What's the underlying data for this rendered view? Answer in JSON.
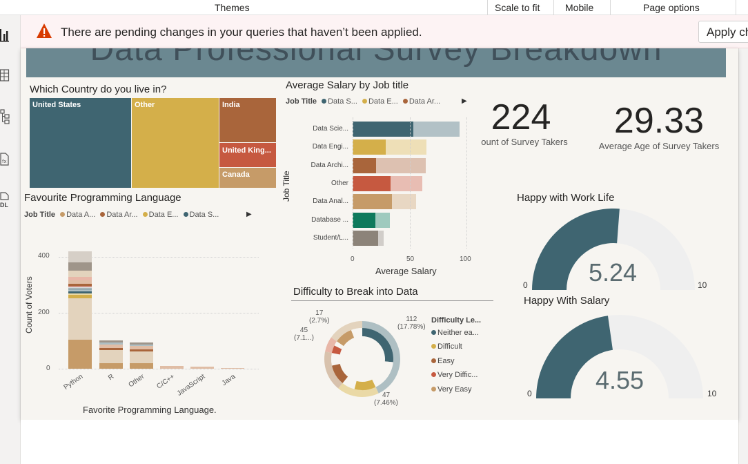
{
  "ribbon": {
    "themes": "Themes",
    "scale_to_fit": "Scale to fit",
    "mobile": "Mobile",
    "page_options": "Page options"
  },
  "warning": {
    "icon": "warning-icon",
    "text": "There are pending changes in your queries that haven’t been applied.",
    "button": "Apply changes"
  },
  "left_rail": {
    "icons": [
      "report-view-icon",
      "table-view-icon",
      "model-view-icon",
      "dax-query-icon",
      "tmdl-view-icon"
    ],
    "tmdl_label": "DL"
  },
  "banner": {
    "title": "Data Professional Survey Breakdown"
  },
  "country": {
    "title": "Which Country do you live in?",
    "items": [
      {
        "label": "United States",
        "color": "#3f6571"
      },
      {
        "label": "Other",
        "color": "#d4af4a"
      },
      {
        "label": "India",
        "color": "#a9653b"
      },
      {
        "label": "United King...",
        "color": "#c65940"
      },
      {
        "label": "Canada",
        "color": "#c69b68"
      }
    ]
  },
  "salary": {
    "title": "Average Salary by Job title",
    "legend_title": "Job Title",
    "legend": [
      {
        "label": "Data S...",
        "color": "#3f6571"
      },
      {
        "label": "Data E...",
        "color": "#d4af4a"
      },
      {
        "label": "Data Ar...",
        "color": "#a9653b"
      }
    ],
    "ylabel": "Job Title",
    "xlabel": "Average Salary",
    "ticks": [
      "0",
      "50",
      "100"
    ]
  },
  "kpi": {
    "survey_takers_value": "224",
    "survey_takers_label": "ount of Survey Takers",
    "avg_age_value": "29.33",
    "avg_age_label": "Average Age of Survey Takers"
  },
  "prog": {
    "title": "Favourite Programming Language",
    "legend_title": "Job Title",
    "legend": [
      {
        "label": "Data A...",
        "color": "#c69b68"
      },
      {
        "label": "Data Ar...",
        "color": "#a9653b"
      },
      {
        "label": "Data E...",
        "color": "#d4af4a"
      },
      {
        "label": "Data S...",
        "color": "#3f6571"
      }
    ],
    "ylabel": "Count of Voters",
    "xlabel": "Favorite Programming Language.",
    "yticks": [
      "400",
      "200",
      "0"
    ]
  },
  "difficulty": {
    "title": "Difficulty to Break into Data",
    "legend_title": "Difficulty Le...",
    "legend": [
      {
        "label": "Neither ea...",
        "color": "#3f6571"
      },
      {
        "label": "Difficult",
        "color": "#d4af4a"
      },
      {
        "label": "Easy",
        "color": "#a9653b"
      },
      {
        "label": "Very Diffic...",
        "color": "#c65940"
      },
      {
        "label": "Very Easy",
        "color": "#c69b68"
      }
    ],
    "labels": {
      "a": "17",
      "a2": "(2.7%)",
      "b": "45",
      "b2": "(7.1...)",
      "c": "112",
      "c2": "(17.78%)",
      "d": "47",
      "d2": "(7.46%)"
    }
  },
  "happy_work": {
    "title": "Happy with Work Life",
    "value": "5.24",
    "min": "0",
    "max": "10",
    "fraction": 0.524,
    "color": "#3f6571"
  },
  "happy_salary": {
    "title": "Happy With Salary",
    "value": "4.55",
    "min": "0",
    "max": "10",
    "fraction": 0.455,
    "color": "#3f6571"
  },
  "chart_data": [
    {
      "type": "bar",
      "title": "Average Salary by Job title",
      "xlabel": "Average Salary",
      "ylabel": "Job Title",
      "xlim": [
        0,
        100
      ],
      "categories": [
        "Data Scie...",
        "Data Engi...",
        "Data Archi...",
        "Other",
        "Data Anal...",
        "Database ...",
        "Student/L..."
      ],
      "values": [
        94,
        65,
        64,
        61,
        56,
        33,
        27
      ],
      "colors": [
        "#3f6571",
        "#d4af4a",
        "#a9653b",
        "#c65940",
        "#c69b68",
        "#0e7a5c",
        "#8c8379"
      ]
    },
    {
      "type": "bar",
      "title": "Favourite Programming Language",
      "xlabel": "Favorite Programming Language.",
      "ylabel": "Count of Voters",
      "ylim": [
        0,
        420
      ],
      "categories": [
        "Python",
        "R",
        "Other",
        "C/C++",
        "JavaScript",
        "Java"
      ],
      "values": [
        420,
        101,
        95,
        11,
        8,
        2
      ]
    },
    {
      "type": "pie",
      "title": "Difficulty to Break into Data",
      "categories": [
        "Neither easy nor difficult",
        "Difficult",
        "Easy",
        "Very Difficult",
        "Very Easy"
      ],
      "values": [
        112,
        47,
        45,
        17,
        40
      ]
    }
  ]
}
